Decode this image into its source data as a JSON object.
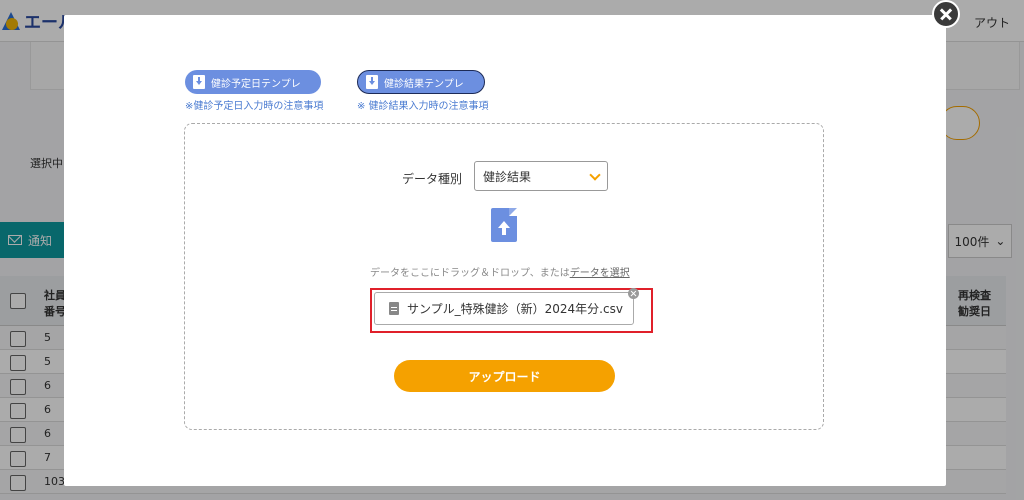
{
  "app": {
    "logo_text": "エール",
    "logout_label": "アウト"
  },
  "background": {
    "selected_label": "選択中",
    "notice_button": "通知",
    "per_page": "100件",
    "header_col1": [
      "社員",
      "番号"
    ],
    "header_last": [
      "再検査",
      "勧奨日"
    ],
    "row_numbers": [
      "5",
      "5",
      "6",
      "6",
      "6",
      "7",
      "103"
    ]
  },
  "modal": {
    "template_buttons": [
      {
        "label": "健診予定日テンプレ",
        "note": "※健診予定日入力時の注意事項"
      },
      {
        "label": "健診結果テンプレ",
        "note": "※ 健診結果入力時の注意事項"
      }
    ],
    "data_type_label": "データ種別",
    "data_type_value": "健診結果",
    "drop_text": "データをここにドラッグ＆ドロップ、または",
    "drop_link": "データを選択",
    "file_name": "サンプル_特殊健診（新）2024年分.csv",
    "upload_label": "アップロード"
  },
  "colors": {
    "primary": "#6c8fe0",
    "accent": "#f5a100",
    "highlight": "#e0202a",
    "teal": "#0d9aa0"
  }
}
